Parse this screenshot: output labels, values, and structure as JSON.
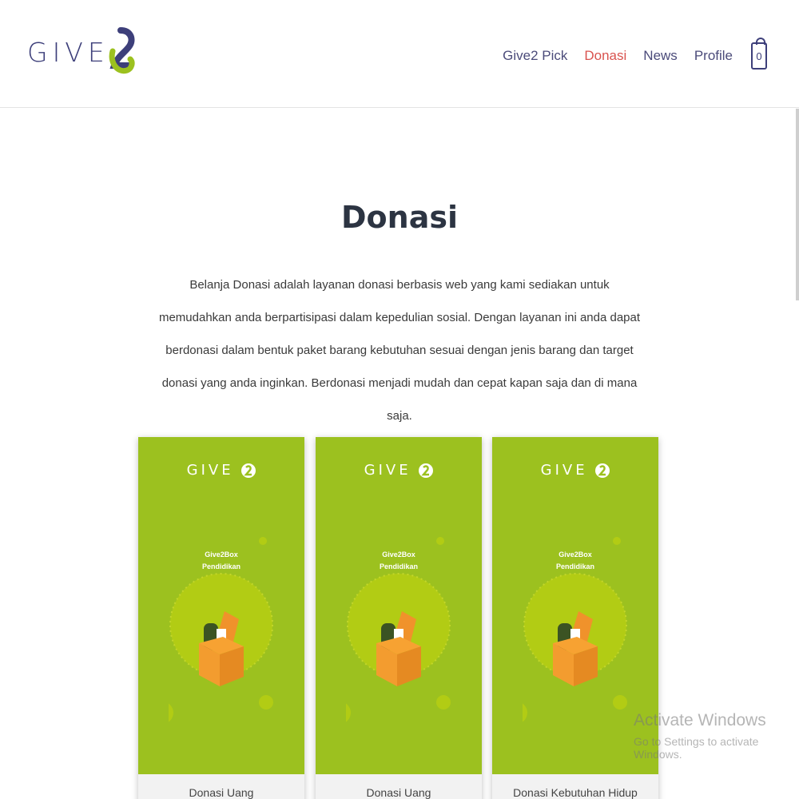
{
  "header": {
    "logo_text": "GIVE",
    "nav": [
      "Give2 Pick",
      "Donasi",
      "News",
      "Profile"
    ],
    "active_nav": "Donasi",
    "cart_count": "0"
  },
  "main": {
    "title": "Donasi",
    "description": "Belanja Donasi adalah layanan donasi berbasis web yang kami sediakan untuk memudahkan anda berpartisipasi dalam kepedulian sosial. Dengan layanan ini anda dapat berdonasi dalam bentuk paket barang kebutuhan sesuai dengan jenis barang dan target donasi yang anda inginkan. Berdonasi menjadi mudah dan cepat kapan saja dan di mana saja."
  },
  "cards": [
    {
      "brand": "GIVE",
      "image_line1": "Give2Box",
      "image_line2": "Pendidikan",
      "caption": "Donasi Uang"
    },
    {
      "brand": "GIVE",
      "image_line1": "Give2Box",
      "image_line2": "Pendidikan",
      "caption": "Donasi Uang"
    },
    {
      "brand": "GIVE",
      "image_line1": "Give2Box",
      "image_line2": "Pendidikan",
      "caption": "Donasi Kebutuhan Hidup"
    }
  ],
  "watermark": {
    "line1": "Activate Windows",
    "line2": "Go to Settings to activate Windows."
  },
  "colors": {
    "brand_navy": "#3d3f7a",
    "brand_green": "#9cc11f",
    "active_link": "#d9534f"
  }
}
